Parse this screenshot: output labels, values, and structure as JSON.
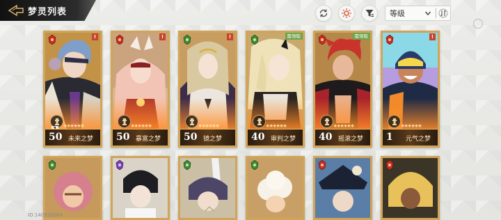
{
  "header": {
    "title": "梦灵列表",
    "sort": {
      "selected": "等级"
    },
    "buttons": [
      "refresh-icon",
      "element-filter-icon",
      "filter-icon"
    ]
  },
  "colors": {
    "card_border": "#d1a457",
    "info_bar": "#3b2815",
    "corner_tag": "#c8442c",
    "pre_tag": "#6ea54b"
  },
  "cards_row1": [
    {
      "level": "50",
      "name": "未来之梦",
      "element": "red",
      "tag": "!",
      "stars": "✦✦✦✦✦✦",
      "rank": "1",
      "pre_tag": ""
    },
    {
      "level": "50",
      "name": "暴富之梦",
      "element": "red",
      "tag": "!",
      "stars": "✦✦✦✦✦✦",
      "rank": "",
      "pre_tag": ""
    },
    {
      "level": "50",
      "name": "镜之梦",
      "element": "green",
      "tag": "!",
      "stars": "✦✦✦✦✦✦",
      "rank": "",
      "pre_tag": ""
    },
    {
      "level": "40",
      "name": "审判之梦",
      "element": "red",
      "tag": "",
      "stars": "✦✦✦✦✦✦",
      "rank": "",
      "pre_tag": "需领取"
    },
    {
      "level": "40",
      "name": "摇滚之梦",
      "element": "red",
      "tag": "",
      "stars": "✦✦✦✦✦✦",
      "rank": "",
      "pre_tag": "需领取"
    },
    {
      "level": "1",
      "name": "元气之梦",
      "element": "red",
      "tag": "!",
      "stars": "✦✦✦✦✦✦",
      "rank": "",
      "pre_tag": ""
    }
  ],
  "cards_row2": [
    {
      "element": "green"
    },
    {
      "element": "purple"
    },
    {
      "element": "green"
    },
    {
      "element": "green"
    },
    {
      "element": "red"
    },
    {
      "element": "red"
    }
  ],
  "footer": {
    "uid": "ID:140930684"
  }
}
